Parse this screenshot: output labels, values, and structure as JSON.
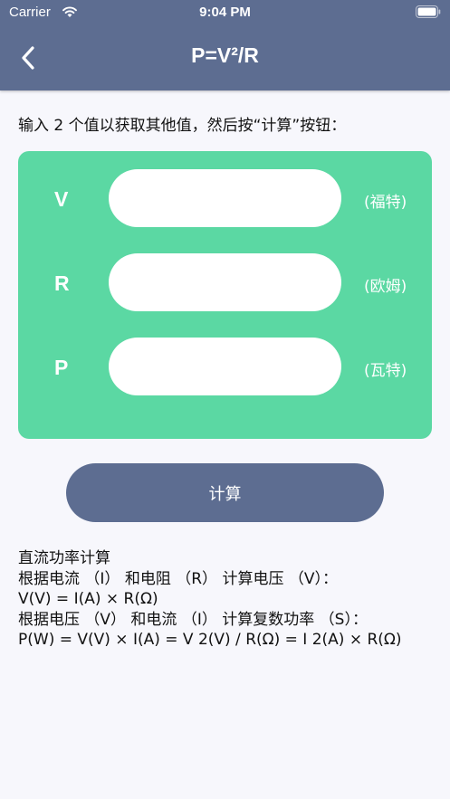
{
  "status_bar": {
    "carrier": "Carrier",
    "time": "9:04 PM"
  },
  "nav": {
    "title": "P=V²/R",
    "back_icon": "chevron-left-icon"
  },
  "instruction": "输入 2 个值以获取其他值，然后按“计算”按钮：",
  "rows": [
    {
      "label": "V",
      "unit": "(福特)",
      "value": ""
    },
    {
      "label": "R",
      "unit": "(欧姆)",
      "value": ""
    },
    {
      "label": "P",
      "unit": "(瓦特)",
      "value": ""
    }
  ],
  "calc_button": "计算",
  "info_lines": [
    "直流功率计算",
    "根据电流 （I） 和电阻 （R） 计算电压 （V）：",
    "V(V) = I(A) × R(Ω)",
    "根据电压 （V） 和电流 （I） 计算复数功率 （S）：",
    "P(W) = V(V) × I(A) = V 2(V) / R(Ω) = I 2(A) × R(Ω)"
  ],
  "colors": {
    "header": "#5d6d91",
    "card": "#5bd8a3",
    "background": "#f7f7fc",
    "button": "#5d6d91"
  }
}
